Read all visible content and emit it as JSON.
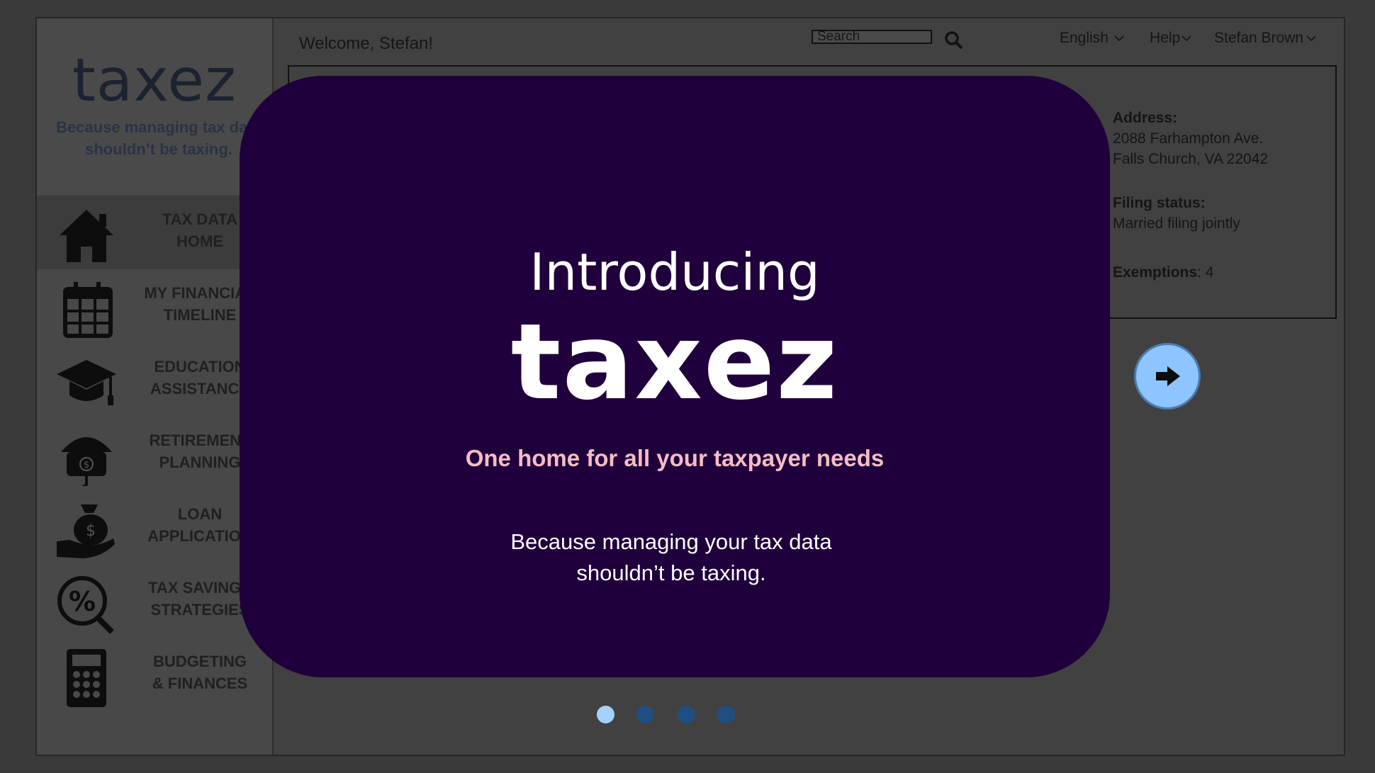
{
  "sidebar": {
    "logo": "taxez",
    "tagline": "Because managing tax data\nshouldn’t be taxing.",
    "items": [
      {
        "label": "TAX DATA\nHOME",
        "icon": "house-icon"
      },
      {
        "label": "MY FINANCIAL\nTIMELINE",
        "icon": "calendar-icon"
      },
      {
        "label": "EDUCATION\nASSISTANCE",
        "icon": "graduation-cap-icon"
      },
      {
        "label": "RETIREMENT\nPLANNING",
        "icon": "umbrella-money-icon"
      },
      {
        "label": "LOAN\nAPPLICATION",
        "icon": "money-bag-hand-icon"
      },
      {
        "label": "TAX SAVINGS\nSTRATEGIES",
        "icon": "percent-magnifier-icon"
      },
      {
        "label": "BUDGETING\n& FINANCES",
        "icon": "calculator-icon"
      }
    ]
  },
  "header": {
    "welcome": "Welcome, Stefan!",
    "search_value": "Search",
    "language": "English",
    "help": "Help",
    "user": "Stefan Brown"
  },
  "profile": {
    "address_label": "Address:",
    "address_line1": "2088 Farhampton Ave.",
    "address_line2": "Falls Church, VA 22042",
    "filing_label": "Filing status:",
    "filing_value": "Married filing jointly",
    "exemptions_label": "Exemptions",
    "exemptions_value": ": 4"
  },
  "modal": {
    "intro": "Introducing",
    "brand": "taxez",
    "tagline": "One home for all your taxpayer needs",
    "description": "Because managing your tax data\nshouldn’t be taxing."
  },
  "carousel": {
    "total": 4,
    "active": 1
  },
  "colors": {
    "modal_bg": "#20003c",
    "tagline": "#f6bcc4",
    "dot_active": "#a4d0ff",
    "dot_inactive": "#1f4f82",
    "next_button": "#8ec4ff"
  }
}
